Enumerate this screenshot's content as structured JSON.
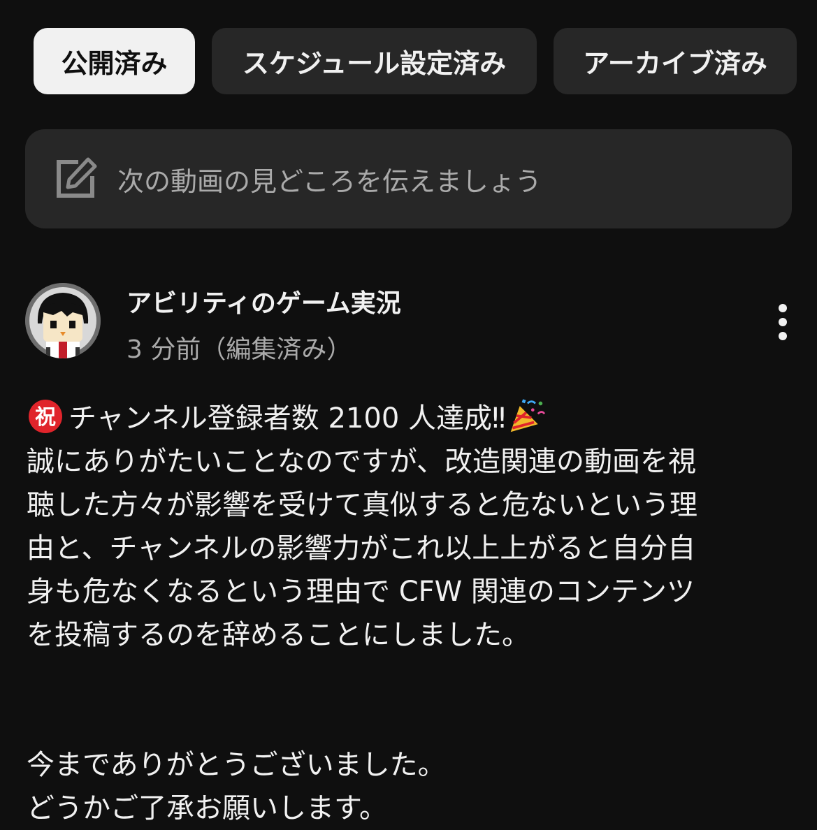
{
  "tabs": [
    {
      "label": "公開済み",
      "active": true
    },
    {
      "label": "スケジュール設定済み",
      "active": false
    },
    {
      "label": "アーカイブ済み",
      "active": false
    }
  ],
  "composer": {
    "icon": "edit-icon",
    "placeholder": "次の動画の見どころを伝えましょう"
  },
  "post": {
    "channel_name": "アビリティのゲーム実況",
    "time": "3 分前（編集済み）",
    "badge_char": "祝",
    "headline": "チャンネル登録者数 2100 人達成",
    "headline_suffix": "‼",
    "headline_emoji": "party-popper-icon",
    "body_lines": [
      "誠にありがたいことなのですが、改造関連の動画を視",
      "聴した方々が影響を受けて真似すると危ないという理",
      "由と、チャンネルの影響力がこれ以上上がると自分自",
      "身も危なくなるという理由で CFW 関連のコンテンツ",
      "を投稿するのを辞めることにしました。"
    ],
    "closing_lines": [
      "今までありがとうございました。",
      "どうかご了承お願いします。"
    ]
  },
  "colors": {
    "background": "#0f0f0f",
    "chip_background": "#272727",
    "chip_active_background": "#f1f1f1",
    "text_primary": "#f1f1f1",
    "text_secondary": "#aaaaaa",
    "badge_red": "#e0242b"
  }
}
